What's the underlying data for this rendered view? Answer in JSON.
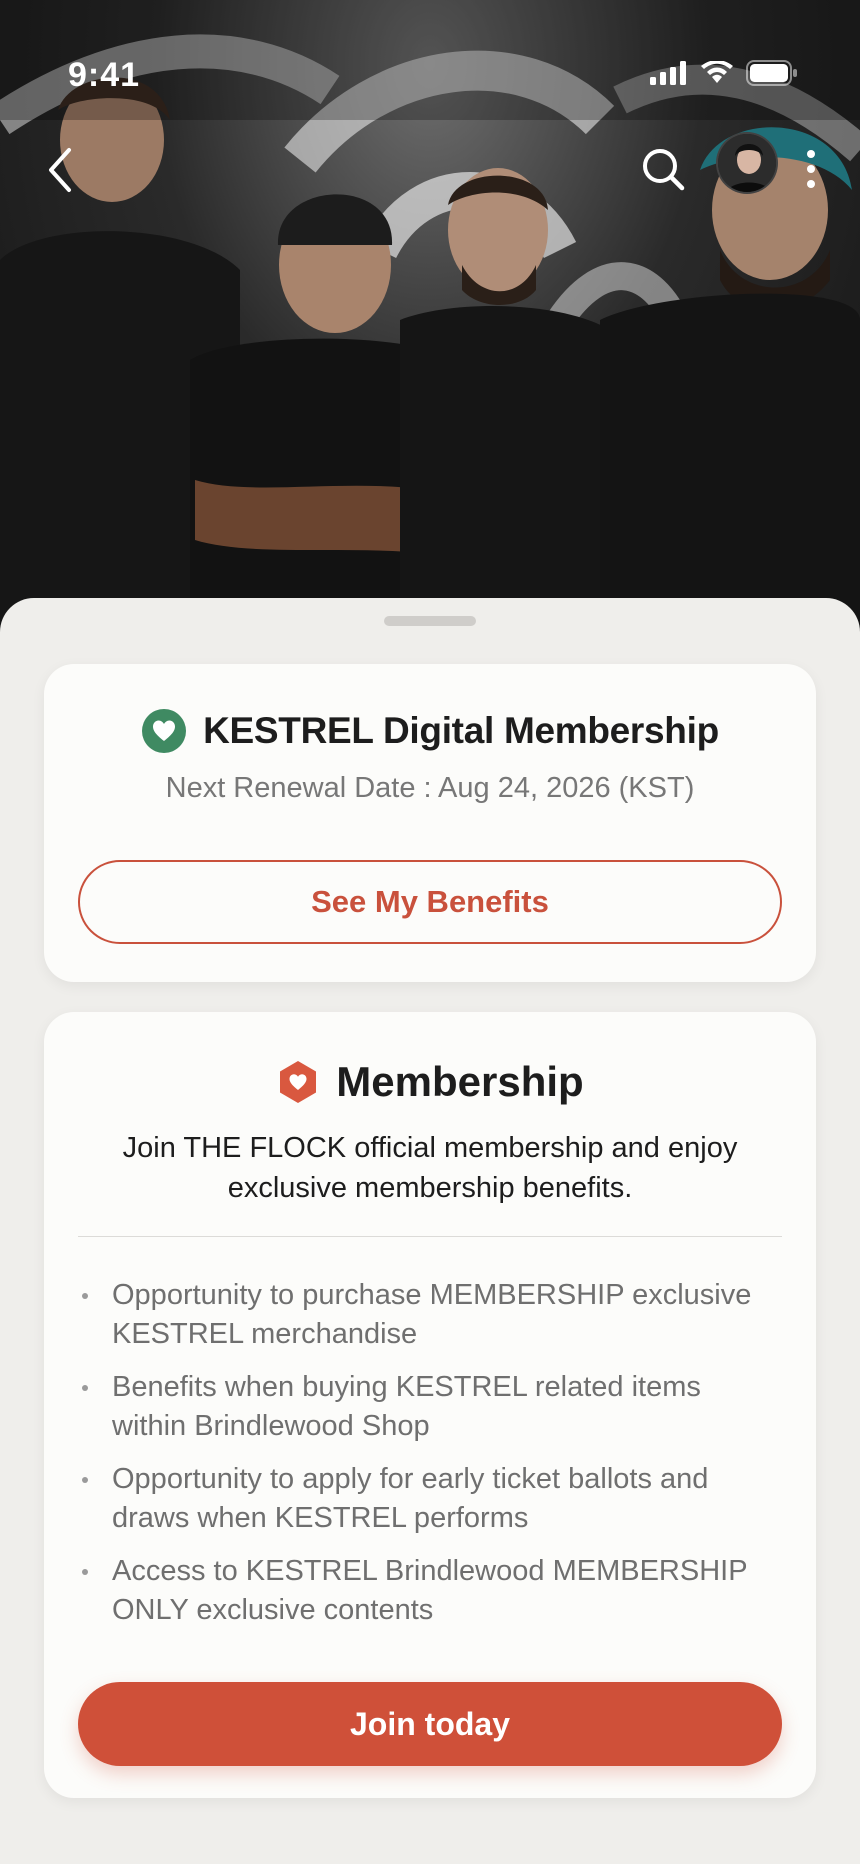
{
  "status_bar": {
    "time": "9:41"
  },
  "nav": {
    "back_icon": "chevron-left-icon",
    "search_icon": "search-icon",
    "more_icon": "more-vertical-icon"
  },
  "membership_card": {
    "title": "KESTREL Digital Membership",
    "renewal": "Next Renewal Date : Aug 24, 2026 (KST)",
    "benefits_button": "See My Benefits",
    "icon": "heart-circle-icon",
    "icon_color": "#3f8a62"
  },
  "join_card": {
    "title": "Membership",
    "icon": "heart-hexagon-icon",
    "icon_color": "#d9583f",
    "description": "Join THE FLOCK official membership and enjoy exclusive membership benefits.",
    "benefits": [
      "Opportunity to purchase MEMBERSHIP exclusive KESTREL merchandise",
      "Benefits when buying KESTREL related items within Brindlewood Shop",
      "Opportunity to apply for early ticket ballots and draws when KESTREL performs",
      "Access to KESTREL Brindlewood MEMBERSHIP ONLY exclusive contents"
    ],
    "join_button": "Join today"
  },
  "colors": {
    "accent": "#cf5039",
    "background": "#efeeeb",
    "card": "#fcfcfa"
  }
}
